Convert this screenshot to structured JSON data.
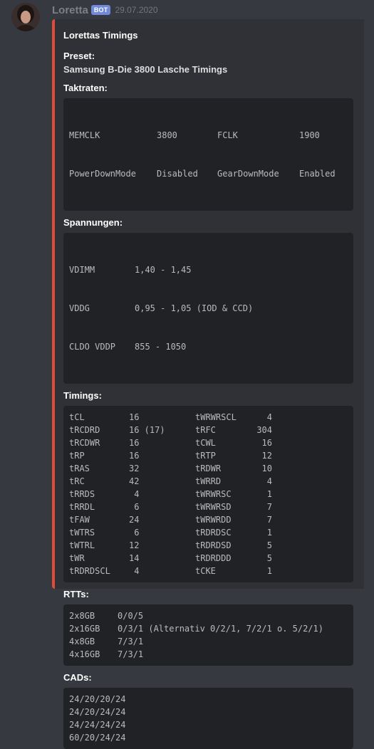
{
  "message": {
    "author": "Loretta",
    "badge": "BOT",
    "timestamp": "29.07.2020"
  },
  "embed": {
    "color": "#e04c3c",
    "title": "Lorettas Timings",
    "preset": {
      "name": "Preset:",
      "value": "Samsung B-Die 3800 Lasche Timings"
    },
    "taktraten": {
      "name": "Taktraten:",
      "rows": [
        [
          "MEMCLK",
          "3800",
          "FCLK",
          "1900"
        ],
        [
          "PowerDownMode",
          "Disabled",
          "GearDownMode",
          "Enabled"
        ]
      ]
    },
    "spannungen": {
      "name": "Spannungen:",
      "rows": [
        [
          "VDIMM",
          "1,40 - 1,45"
        ],
        [
          "VDDG",
          "0,95 - 1,05 (IOD & CCD)"
        ],
        [
          "CLDO VDDP",
          "855 - 1050"
        ]
      ]
    },
    "timings": {
      "name": "Timings:",
      "rows": [
        [
          "tCL",
          "16",
          "tWRWRSCL",
          "4"
        ],
        [
          "tRCDRD",
          "16 (17)",
          "tRFC",
          "304"
        ],
        [
          "tRCDWR",
          "16",
          "tCWL",
          "16"
        ],
        [
          "tRP",
          "16",
          "tRTP",
          "12"
        ],
        [
          "tRAS",
          "32",
          "tRDWR",
          "10"
        ],
        [
          "tRC",
          "42",
          "tWRRD",
          "4"
        ],
        [
          "tRRDS",
          "4",
          "tWRWRSC",
          "1"
        ],
        [
          "tRRDL",
          "6",
          "tWRWRSD",
          "7"
        ],
        [
          "tFAW",
          "24",
          "tWRWRDD",
          "7"
        ],
        [
          "tWTRS",
          "6",
          "tRDRDSC",
          "1"
        ],
        [
          "tWTRL",
          "12",
          "tRDRDSD",
          "5"
        ],
        [
          "tWR",
          "14",
          "tRDRDDD",
          "5"
        ],
        [
          "tRDRDSCL",
          "4",
          "tCKE",
          "1"
        ]
      ]
    },
    "rtts": {
      "name": "RTTs:",
      "rows": [
        [
          "2x8GB",
          "0/0/5"
        ],
        [
          "2x16GB",
          "0/3/1 (Alternativ 0/2/1, 7/2/1 o. 5/2/1)"
        ],
        [
          "4x8GB",
          "7/3/1"
        ],
        [
          "4x16GB",
          "7/3/1"
        ]
      ]
    },
    "cads": {
      "name": "CADs:",
      "lines": [
        "24/20/20/24",
        "24/20/24/24",
        "24/24/24/24",
        "60/20/24/24"
      ]
    }
  }
}
